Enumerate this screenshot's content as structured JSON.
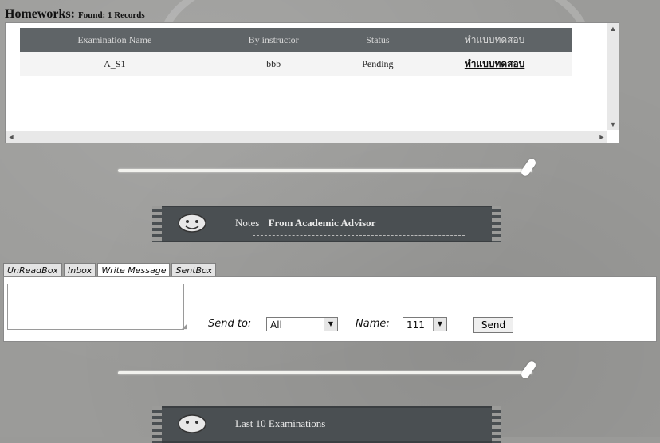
{
  "homeworks": {
    "title": "Homeworks:",
    "count_label": "Found: 1 Records",
    "columns": [
      "Examination Name",
      "By instructor",
      "Status",
      "ทำแบบทดสอบ"
    ],
    "rows": [
      {
        "name": "A_S1",
        "instructor": "bbb",
        "status": "Pending",
        "action": "ทำแบบทดสอบ"
      }
    ]
  },
  "notes_banner": {
    "prefix": "Notes",
    "title": "From Academic Advisor"
  },
  "message": {
    "tabs": [
      "UnReadBox",
      "Inbox",
      "Write Message",
      "SentBox"
    ],
    "active_tab": "Write Message",
    "body_value": "",
    "send_to_label": "Send to:",
    "send_to_value": "All",
    "name_label": "Name:",
    "name_value": "111",
    "send_button": "Send"
  },
  "exams_banner": {
    "title": "Last 10 Examinations"
  },
  "icons": {
    "chevron_up": "▲",
    "chevron_down": "▼",
    "chevron_left": "◄",
    "chevron_right": "►",
    "dropdown": "▼"
  }
}
